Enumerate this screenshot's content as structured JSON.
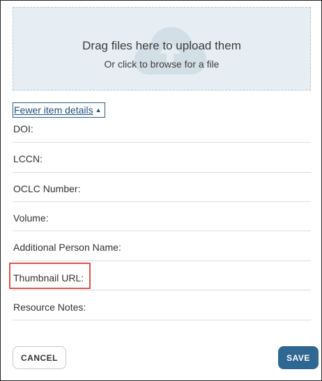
{
  "upload": {
    "title": "Drag files here to upload them",
    "subtitle": "Or click to browse for a file",
    "icon": "cloud-upload-icon"
  },
  "toggle": {
    "label": "Fewer item details",
    "caret": "▲"
  },
  "fields": [
    {
      "label": "DOI:"
    },
    {
      "label": "LCCN:"
    },
    {
      "label": "OCLC Number:"
    },
    {
      "label": "Volume:"
    },
    {
      "label": "Additional Person Name:"
    },
    {
      "label": "Thumbnail URL:",
      "highlighted": true
    },
    {
      "label": "Resource Notes:"
    }
  ],
  "buttons": {
    "cancel": "CANCEL",
    "save": "SAVE"
  },
  "colors": {
    "dropzone_bg": "#e6eef3",
    "accent": "#2e6791",
    "highlight": "#d9534f"
  }
}
